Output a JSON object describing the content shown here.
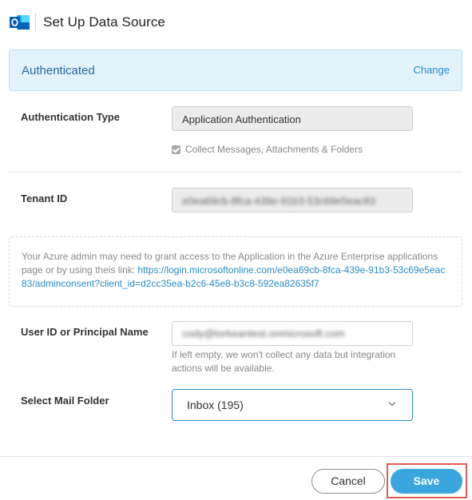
{
  "header": {
    "title": "Set Up Data Source",
    "app_icon": "outlook-icon"
  },
  "auth_banner": {
    "status": "Authenticated",
    "change_label": "Change"
  },
  "auth_type": {
    "label": "Authentication Type",
    "value": "Application Authentication",
    "checkbox_label": "Collect Messages, Attachments & Folders",
    "checkbox_checked": true
  },
  "tenant": {
    "label": "Tenant ID",
    "value": "e0ea69cb-8fca-439e-91b3-53c69e5eac83"
  },
  "info": {
    "text": "Your Azure admin may need to grant access to the Application in the Azure Enterprise applications page or by using theis link: ",
    "link": "https://login.microsoftonline.com/e0ea69cb-8fca-439e-91b3-53c69e5eac83/adminconsent?client_id=d2cc35ea-b2c6-45e8-b3c8-592ea82635f7"
  },
  "user": {
    "label": "User ID or Principal Name",
    "value": "cody@torkeantest.onmicrosoft.com",
    "hint": "If left empty, we won't collect any data but integration actions will be available."
  },
  "mail_folder": {
    "label": "Select Mail Folder",
    "selected": "Inbox (195)"
  },
  "footer": {
    "cancel_label": "Cancel",
    "save_label": "Save"
  },
  "colors": {
    "accent": "#39a6dd",
    "banner_bg": "#e3f3fb",
    "highlight": "#e25c52"
  }
}
